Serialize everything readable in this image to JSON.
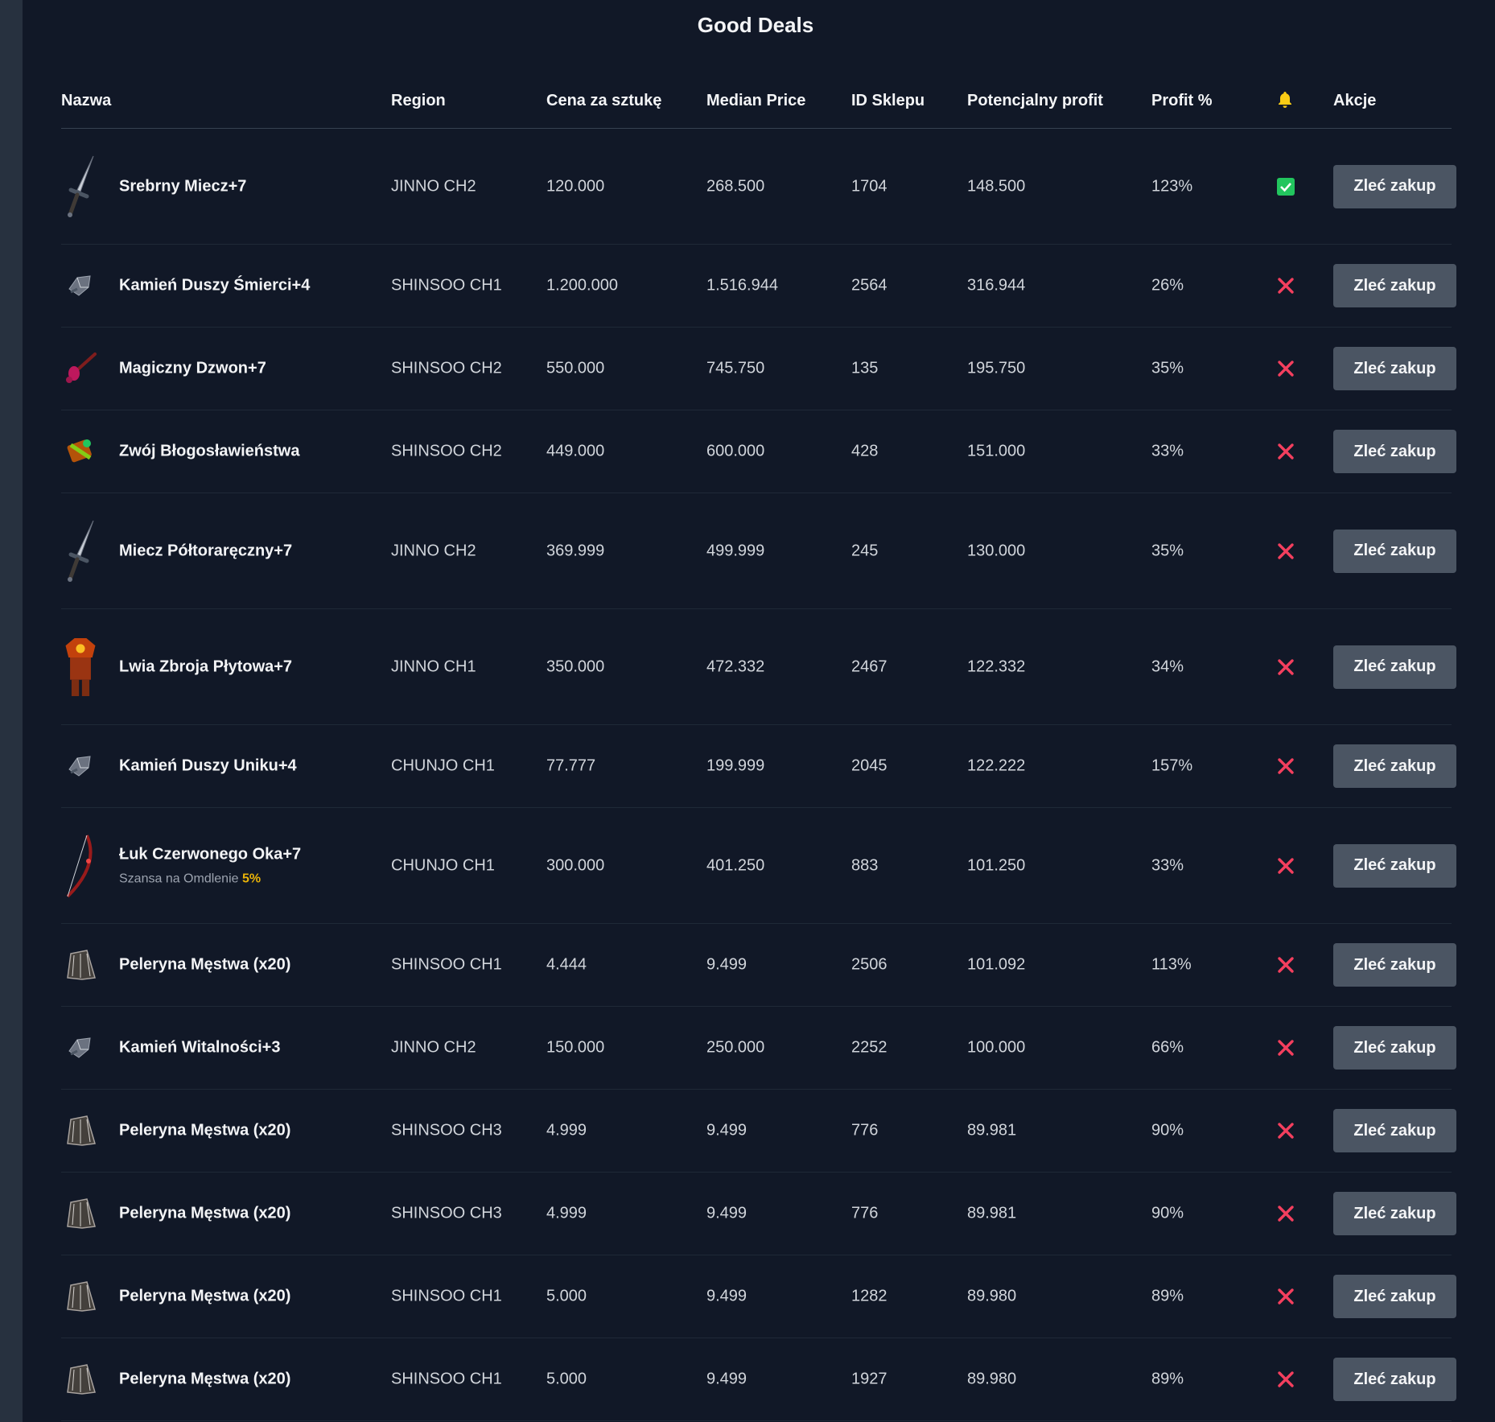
{
  "title": "Good Deals",
  "columns": {
    "name": "Nazwa",
    "region": "Region",
    "price": "Cena za sztukę",
    "median": "Median Price",
    "shop": "ID Sklepu",
    "profit": "Potencjalny profit",
    "pct": "Profit %",
    "alert": "bell-icon",
    "actions": "Akcje"
  },
  "colors": {
    "background": "#111827",
    "button": "#4b5563",
    "check": "#22c55e",
    "cross": "#f43f5e",
    "bell": "#facc15",
    "highlight": "#eab308"
  },
  "rows": [
    {
      "name": "Srebrny Miecz+7",
      "icon": "sword-icon",
      "region": "JINNO CH2",
      "price": "120.000",
      "median": "268.500",
      "shop": "1704",
      "profit": "148.500",
      "pct": "123%",
      "status": "check",
      "action": "Zleć zakup"
    },
    {
      "name": "Kamień Duszy Śmierci+4",
      "icon": "stone-icon",
      "region": "SHINSOO CH1",
      "price": "1.200.000",
      "median": "1.516.944",
      "shop": "2564",
      "profit": "316.944",
      "pct": "26%",
      "status": "cross",
      "action": "Zleć zakup"
    },
    {
      "name": "Magiczny Dzwon+7",
      "icon": "bell-weapon-icon",
      "region": "SHINSOO CH2",
      "price": "550.000",
      "median": "745.750",
      "shop": "135",
      "profit": "195.750",
      "pct": "35%",
      "status": "cross",
      "action": "Zleć zakup"
    },
    {
      "name": "Zwój Błogosławieństwa",
      "icon": "scroll-icon",
      "region": "SHINSOO CH2",
      "price": "449.000",
      "median": "600.000",
      "shop": "428",
      "profit": "151.000",
      "pct": "33%",
      "status": "cross",
      "action": "Zleć zakup"
    },
    {
      "name": "Miecz Półtoraręczny+7",
      "icon": "sword-icon",
      "region": "JINNO CH2",
      "price": "369.999",
      "median": "499.999",
      "shop": "245",
      "profit": "130.000",
      "pct": "35%",
      "status": "cross",
      "action": "Zleć zakup"
    },
    {
      "name": "Lwia Zbroja Płytowa+7",
      "icon": "armor-icon",
      "region": "JINNO CH1",
      "price": "350.000",
      "median": "472.332",
      "shop": "2467",
      "profit": "122.332",
      "pct": "34%",
      "status": "cross",
      "action": "Zleć zakup"
    },
    {
      "name": "Kamień Duszy Uniku+4",
      "icon": "stone-icon",
      "region": "CHUNJO CH1",
      "price": "77.777",
      "median": "199.999",
      "shop": "2045",
      "profit": "122.222",
      "pct": "157%",
      "status": "cross",
      "action": "Zleć zakup"
    },
    {
      "name": "Łuk Czerwonego Oka+7",
      "icon": "bow-icon",
      "sub_label": "Szansa na Omdlenie",
      "sub_value": "5%",
      "region": "CHUNJO CH1",
      "price": "300.000",
      "median": "401.250",
      "shop": "883",
      "profit": "101.250",
      "pct": "33%",
      "status": "cross",
      "action": "Zleć zakup"
    },
    {
      "name": "Peleryna Męstwa (x20)",
      "icon": "cape-icon",
      "region": "SHINSOO CH1",
      "price": "4.444",
      "median": "9.499",
      "shop": "2506",
      "profit": "101.092",
      "pct": "113%",
      "status": "cross",
      "action": "Zleć zakup"
    },
    {
      "name": "Kamień Witalności+3",
      "icon": "stone-icon",
      "region": "JINNO CH2",
      "price": "150.000",
      "median": "250.000",
      "shop": "2252",
      "profit": "100.000",
      "pct": "66%",
      "status": "cross",
      "action": "Zleć zakup"
    },
    {
      "name": "Peleryna Męstwa (x20)",
      "icon": "cape-icon",
      "region": "SHINSOO CH3",
      "price": "4.999",
      "median": "9.499",
      "shop": "776",
      "profit": "89.981",
      "pct": "90%",
      "status": "cross",
      "action": "Zleć zakup"
    },
    {
      "name": "Peleryna Męstwa (x20)",
      "icon": "cape-icon",
      "region": "SHINSOO CH3",
      "price": "4.999",
      "median": "9.499",
      "shop": "776",
      "profit": "89.981",
      "pct": "90%",
      "status": "cross",
      "action": "Zleć zakup"
    },
    {
      "name": "Peleryna Męstwa (x20)",
      "icon": "cape-icon",
      "region": "SHINSOO CH1",
      "price": "5.000",
      "median": "9.499",
      "shop": "1282",
      "profit": "89.980",
      "pct": "89%",
      "status": "cross",
      "action": "Zleć zakup"
    },
    {
      "name": "Peleryna Męstwa (x20)",
      "icon": "cape-icon",
      "region": "SHINSOO CH1",
      "price": "5.000",
      "median": "9.499",
      "shop": "1927",
      "profit": "89.980",
      "pct": "89%",
      "status": "cross",
      "action": "Zleć zakup"
    }
  ]
}
